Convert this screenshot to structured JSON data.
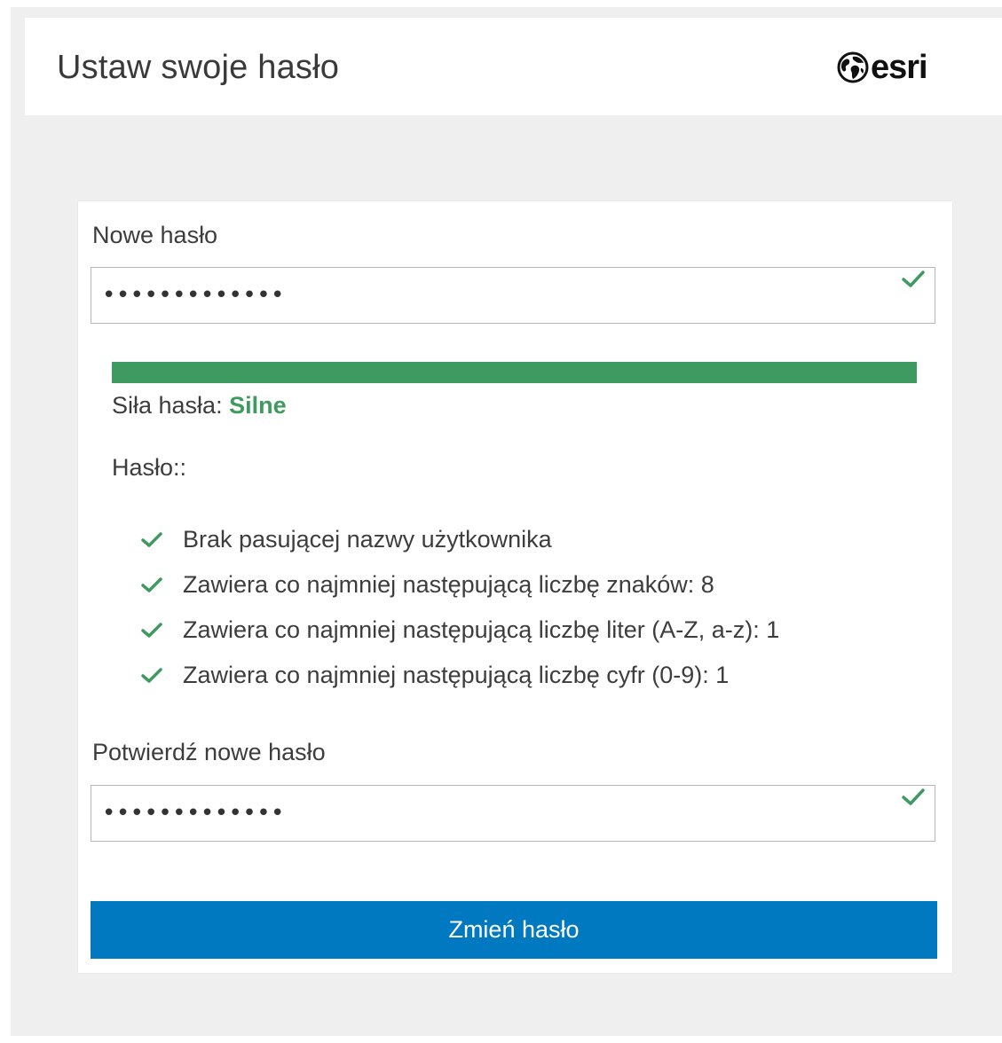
{
  "header": {
    "title": "Ustaw swoje hasło",
    "logo_text": "esri",
    "logo_icon": "globe-icon"
  },
  "form": {
    "new_password": {
      "label": "Nowe hasło",
      "value_masked": "•••••••••••••",
      "valid_icon": "checkmark-icon"
    },
    "strength": {
      "label": "Siła hasła:",
      "value": "Silne",
      "level": 1.0,
      "color": "#3e9a60"
    },
    "rules": {
      "title": "Hasło::",
      "items": [
        {
          "text": "Brak pasującej nazwy użytkownika",
          "met": true
        },
        {
          "text": "Zawiera co najmniej następującą liczbę znaków: 8",
          "met": true
        },
        {
          "text": "Zawiera co najmniej następującą liczbę liter (A-Z, a-z): 1",
          "met": true
        },
        {
          "text": "Zawiera co najmniej następującą liczbę cyfr (0-9): 1",
          "met": true
        }
      ]
    },
    "confirm_password": {
      "label": "Potwierdź nowe hasło",
      "value_masked": "•••••••••••••",
      "valid_icon": "checkmark-icon"
    },
    "submit_label": "Zmień hasło"
  },
  "colors": {
    "accent": "#0079c1",
    "success": "#3e9a60"
  }
}
